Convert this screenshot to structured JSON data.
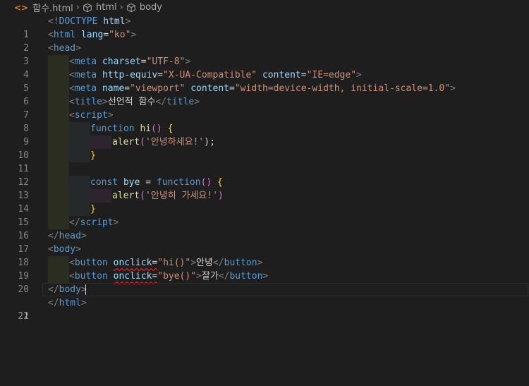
{
  "breadcrumb": {
    "file_icon_glyph": "<>",
    "file": "함수.html",
    "separator": "›",
    "crumbs": [
      "html",
      "body"
    ]
  },
  "editor": {
    "current_line": 21,
    "line_numbers": [
      "1",
      "2",
      "3",
      "4",
      "5",
      "6",
      "7",
      "8",
      "9",
      "10",
      "11",
      "12",
      "13",
      "14",
      "15",
      "16",
      "17",
      "18",
      "19",
      "20",
      "21",
      "22"
    ],
    "l1": [
      "<!",
      "DOCTYPE",
      " ",
      "html",
      ">"
    ],
    "l2": [
      "<",
      "html",
      " ",
      "lang",
      "=",
      "\"ko\"",
      ">"
    ],
    "l3": [
      "<",
      "head",
      ">"
    ],
    "l4": [
      "<",
      "meta",
      " ",
      "charset",
      "=",
      "\"UTF-8\"",
      ">"
    ],
    "l5": [
      "<",
      "meta",
      " ",
      "http-equiv",
      "=",
      "\"X-UA-Compatible\"",
      " ",
      "content",
      "=",
      "\"IE=edge\"",
      ">"
    ],
    "l6": [
      "<",
      "meta",
      " ",
      "name",
      "=",
      "\"viewport\"",
      " ",
      "content",
      "=",
      "\"width=device-width, initial-scale=1.0\"",
      ">"
    ],
    "l7": [
      "<",
      "title",
      ">",
      "선언적 함수",
      "</",
      "title",
      ">"
    ],
    "l8": [
      "<",
      "script",
      ">"
    ],
    "l9": [
      "function",
      " ",
      "hi",
      "()",
      " ",
      "{"
    ],
    "l10": [
      "alert",
      "(",
      "'안녕하세요!'",
      ");"
    ],
    "l11": [
      "}"
    ],
    "l13": [
      "const",
      " ",
      "bye",
      " = ",
      "function",
      "()",
      " ",
      "{"
    ],
    "l14": [
      "alert",
      "(",
      "'안녕히 가세요!'",
      ")"
    ],
    "l15": [
      "}"
    ],
    "l16": [
      "</",
      "script",
      ">"
    ],
    "l17": [
      "</",
      "head",
      ">"
    ],
    "l18": [
      "<",
      "body",
      ">"
    ],
    "l19": [
      "<",
      "button",
      " ",
      "onclick",
      "=",
      "\"hi()\"",
      ">",
      "안녕",
      "</",
      "button",
      ">"
    ],
    "l20": [
      "<",
      "button",
      " ",
      "onclick",
      "=",
      "\"bye()\"",
      ">",
      "잘가",
      "</",
      "button",
      ">"
    ],
    "l21": [
      "</",
      "body",
      ">"
    ],
    "l22": [
      "</",
      "html",
      ">"
    ]
  },
  "colors": {
    "background": "#1e1e1e",
    "tag": "#569cd6",
    "attribute": "#9cdcfe",
    "string": "#ce9178",
    "function": "#dcdcaa",
    "brace": "#ffd700",
    "squiggle": "#e02020"
  }
}
